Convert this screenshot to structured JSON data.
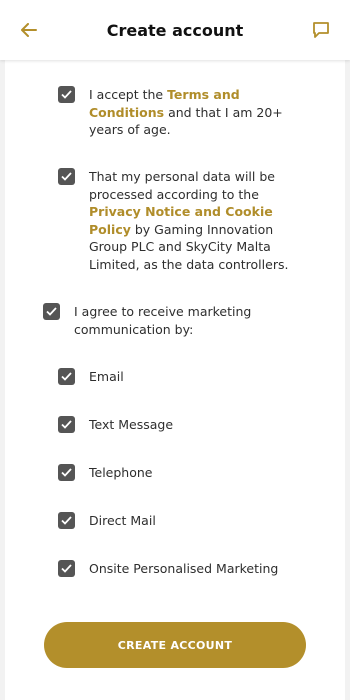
{
  "header": {
    "title": "Create account",
    "back_icon": "arrow-left-icon",
    "chat_icon": "chat-bubble-icon"
  },
  "colors": {
    "accent": "#b38f2b",
    "checkbox": "#555555"
  },
  "consents": {
    "terms": {
      "checked": true,
      "pre": "I accept the ",
      "link": "Terms and Conditions",
      "post": " and that I am 20+ years of age."
    },
    "privacy": {
      "checked": true,
      "pre": "That my personal data will be processed according to the ",
      "link": "Privacy Notice and Cookie Policy",
      "post": " by Gaming Innovation Group PLC and SkyCity Malta Limited, as the data controllers."
    },
    "marketing": {
      "checked": true,
      "label": "I agree to receive marketing communication by:"
    },
    "channels": [
      {
        "label": "Email",
        "checked": true
      },
      {
        "label": "Text Message",
        "checked": true
      },
      {
        "label": "Telephone",
        "checked": true
      },
      {
        "label": "Direct Mail",
        "checked": true
      },
      {
        "label": "Onsite Personalised Marketing",
        "checked": true
      }
    ]
  },
  "submit": {
    "label": "CREATE ACCOUNT"
  }
}
